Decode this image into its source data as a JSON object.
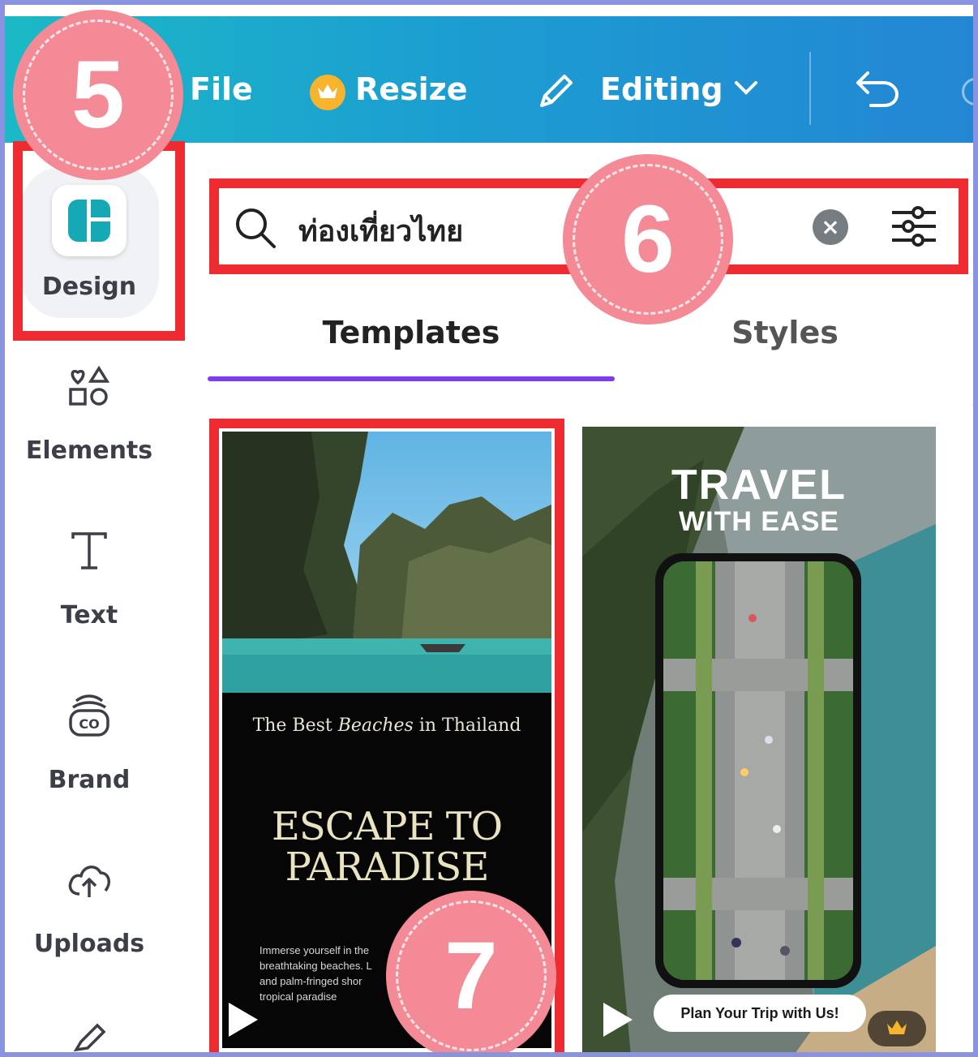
{
  "topbar": {
    "file_label": "File",
    "resize_label": "Resize",
    "editing_label": "Editing",
    "icons": [
      "crown-icon",
      "pencil-icon",
      "chevron-down-icon",
      "undo-icon"
    ]
  },
  "sidebar": {
    "items": [
      {
        "label": "Design",
        "icon": "design-layout-icon"
      },
      {
        "label": "Elements",
        "icon": "shapes-icon"
      },
      {
        "label": "Text",
        "icon": "text-t-icon"
      },
      {
        "label": "Brand",
        "icon": "brand-kit-icon"
      },
      {
        "label": "Uploads",
        "icon": "cloud-upload-icon"
      }
    ]
  },
  "search": {
    "value": "ท่องเที่ยวไทย"
  },
  "tabs": [
    {
      "label": "Templates",
      "active": true
    },
    {
      "label": "Styles",
      "active": false
    }
  ],
  "templates": [
    {
      "subtitle_prefix": "The Best ",
      "subtitle_italic": "Beaches",
      "subtitle_suffix": " in Thailand",
      "title_line1": "ESCAPE TO",
      "title_line2": "PARADISE",
      "body_line1": "Immerse yourself in the",
      "body_line2": "breathtaking beaches. L",
      "body_line3": "and palm-fringed shor",
      "body_line4": "tropical paradise"
    },
    {
      "title_line1": "TRAVEL",
      "title_line2": "WITH EASE",
      "button_label": "Plan Your Trip with Us!",
      "badge_icon": "crown-icon"
    }
  ],
  "annotations": {
    "step5": "5",
    "step6": "6",
    "step7": "7",
    "highlight_color": "#ef2b32",
    "badge_color": "#f48a96"
  },
  "colors": {
    "accent_tab": "#7d3cf0",
    "brand_teal": "#1bb9c6"
  }
}
